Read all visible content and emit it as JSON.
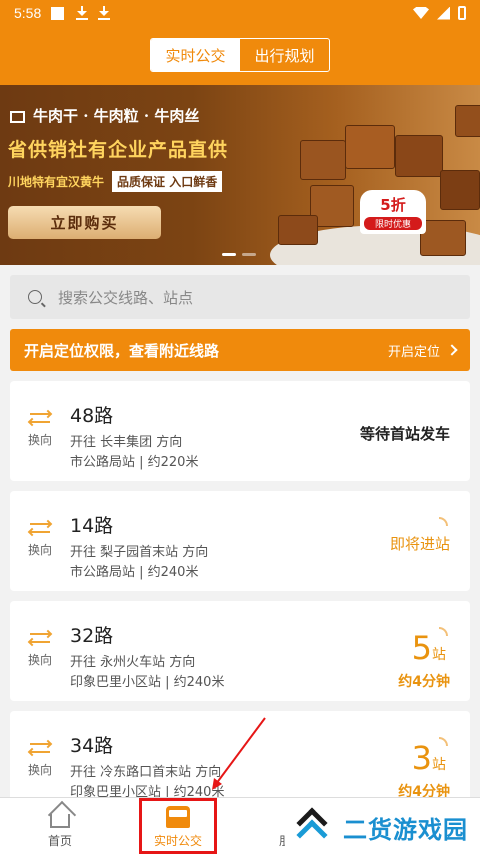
{
  "status_bar": {
    "time": "5:58"
  },
  "header": {
    "tabs": [
      "实时公交",
      "出行规划"
    ]
  },
  "banner": {
    "line1": "牛肉干 · 牛肉粒 · 牛肉丝",
    "line2": "省供销社有企业产品直供",
    "line3a": "川地特有宜汉黄牛",
    "line3b": "品质保证 入口鲜香",
    "buy_label": "立即购买",
    "discount": "5折",
    "discount_tag": "限时优惠"
  },
  "search": {
    "placeholder": "搜索公交线路、站点"
  },
  "location_bar": {
    "message": "开启定位权限，查看附近线路",
    "action": "开启定位"
  },
  "swap_label": "换向",
  "routes": [
    {
      "name": "48路",
      "direction": "开往 长丰集团 方向",
      "stop": "市公路局站 | 约220米",
      "status": "等待首站发车"
    },
    {
      "name": "14路",
      "direction": "开往 梨子园首末站 方向",
      "stop": "市公路局站 | 约240米",
      "status": "即将进站"
    },
    {
      "name": "32路",
      "direction": "开往 永州火车站 方向",
      "stop": "印象巴里小区站 | 约240米",
      "stations": "5",
      "station_unit": "站",
      "eta": "约4分钟"
    },
    {
      "name": "34路",
      "direction": "开往 冷东路口首末站 方向",
      "stop": "印象巴里小区站 | 约240米",
      "stations": "3",
      "station_unit": "站",
      "eta": "约4分钟"
    }
  ],
  "tabbar": {
    "home": "首页",
    "realtime": "实时公交",
    "third_partial": "朋"
  },
  "watermark": {
    "text": "二货游戏园"
  },
  "colors": {
    "accent": "#f08a0c",
    "highlight": "#e61616"
  }
}
